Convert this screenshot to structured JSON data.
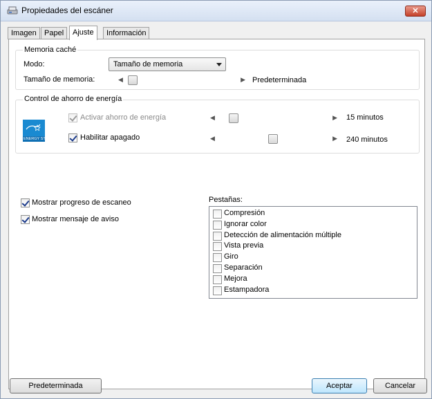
{
  "window": {
    "title": "Propiedades del escáner",
    "close_label": "✕"
  },
  "tabs": [
    {
      "label": "Imagen",
      "active": false
    },
    {
      "label": "Papel",
      "active": false
    },
    {
      "label": "Ajuste",
      "active": true
    },
    {
      "label": "Información",
      "active": false
    }
  ],
  "cache": {
    "group_title": "Memoria caché",
    "mode_label": "Modo:",
    "mode_value": "Tamaño de memoria",
    "memory_size_label": "Tamaño de memoria:",
    "memory_size_value": "Predeterminada",
    "memory_slider_level": 0.02
  },
  "power": {
    "group_title": "Control de ahorro de energía",
    "logo_text": "ENERGY STAR",
    "energy_saving_label": "Activar ahorro de energía",
    "energy_saving_checked": true,
    "energy_saving_disabled": true,
    "energy_saving_value": "15 minutos",
    "energy_slider_level": 0.1,
    "shutdown_label": "Habilitar apagado",
    "shutdown_checked": true,
    "shutdown_value": "240 minutos",
    "shutdown_slider_level": 0.5
  },
  "options": {
    "progress_label": "Mostrar progreso de escaneo",
    "progress_checked": true,
    "warning_label": "Mostrar mensaje de aviso",
    "warning_checked": true
  },
  "tabs_list": {
    "title": "Pestañas:",
    "items": [
      {
        "label": "Compresión",
        "checked": false
      },
      {
        "label": "Ignorar color",
        "checked": false
      },
      {
        "label": "Detección de alimentación múltiple",
        "checked": false
      },
      {
        "label": "Vista previa",
        "checked": false
      },
      {
        "label": "Giro",
        "checked": false
      },
      {
        "label": "Separación",
        "checked": false
      },
      {
        "label": "Mejora",
        "checked": false
      },
      {
        "label": "Estampadora",
        "checked": false
      }
    ]
  },
  "buttons": {
    "default_label": "Predeterminada",
    "accept_label": "Aceptar",
    "cancel_label": "Cancelar"
  }
}
